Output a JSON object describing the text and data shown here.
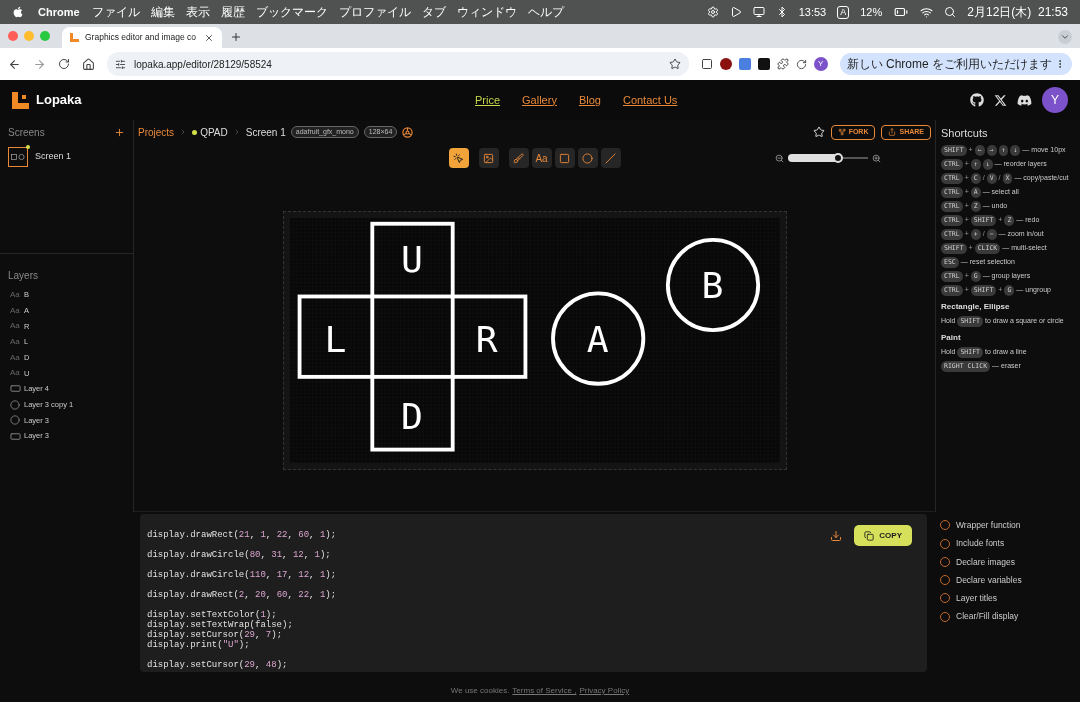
{
  "menu_bar": {
    "app": "Chrome",
    "items": [
      "ファイル",
      "編集",
      "表示",
      "履歴",
      "ブックマーク",
      "プロファイル",
      "タブ",
      "ウィンドウ",
      "ヘルプ"
    ],
    "time_small": "13:53",
    "input_mode": "A",
    "battery": "12%",
    "datetime": "2月12日(木)  21:53"
  },
  "browser": {
    "tab_title": "Graphics editor and image co",
    "url": "lopaka.app/editor/28129/58524",
    "profile": "Y",
    "update_button": "新しい Chrome をご利用いただけます"
  },
  "header": {
    "logo": "Lopaka",
    "nav": [
      {
        "label": "Price",
        "selected": true
      },
      {
        "label": "Gallery",
        "selected": false
      },
      {
        "label": "Blog",
        "selected": false
      },
      {
        "label": "Contact Us",
        "selected": false
      }
    ],
    "avatar": "Y"
  },
  "sidebar": {
    "screens_title": "Screens",
    "screens": [
      {
        "name": "Screen 1",
        "selected": true
      }
    ],
    "layers_title": "Layers",
    "layers": [
      {
        "kind": "text",
        "glyph": "Aa",
        "name": "B"
      },
      {
        "kind": "text",
        "glyph": "Aa",
        "name": "A"
      },
      {
        "kind": "text",
        "glyph": "Aa",
        "name": "R"
      },
      {
        "kind": "text",
        "glyph": "Aa",
        "name": "L"
      },
      {
        "kind": "text",
        "glyph": "Aa",
        "name": "D"
      },
      {
        "kind": "text",
        "glyph": "Aa",
        "name": "U"
      },
      {
        "kind": "rect",
        "name": "Layer 4"
      },
      {
        "kind": "circle",
        "name": "Layer 3 copy 1"
      },
      {
        "kind": "circle",
        "name": "Layer 3"
      },
      {
        "kind": "rect",
        "name": "Layer 3"
      }
    ]
  },
  "toolbar": {
    "breadcrumbs": [
      {
        "kind": "link",
        "label": "Projects"
      },
      {
        "kind": "project",
        "label": "QPAD"
      },
      {
        "kind": "current",
        "label": "Screen 1"
      }
    ],
    "badges": [
      "adafruit_gfx_mono",
      "128×64"
    ],
    "tools": [
      {
        "kind": "pointer",
        "selected": true
      },
      {
        "kind": "image",
        "selected": false
      },
      {
        "kind": "paint",
        "selected": false
      },
      {
        "kind": "text",
        "label": "Aa",
        "selected": false
      },
      {
        "kind": "rect",
        "selected": false
      },
      {
        "kind": "circle",
        "selected": false
      },
      {
        "kind": "line",
        "selected": false
      }
    ],
    "fork": "FORK",
    "share": "SHARE",
    "zoom": {
      "level": 0.62
    }
  },
  "canvas": {
    "letters": [
      "U",
      "L",
      "R",
      "D",
      "A",
      "B"
    ]
  },
  "shortcuts": {
    "title": "Shortcuts",
    "rows": [
      {
        "kind": "keys",
        "parts": [
          {
            "kind": "key",
            "text": "SHIFT"
          },
          {
            "kind": "sep",
            "text": "+"
          },
          {
            "kind": "key",
            "text": "←"
          },
          {
            "kind": "key",
            "text": "→"
          },
          {
            "kind": "key",
            "text": "↑"
          },
          {
            "kind": "key",
            "text": "↓"
          },
          {
            "kind": "text",
            "text": "— move 10px"
          }
        ]
      },
      {
        "kind": "keys",
        "parts": [
          {
            "kind": "key",
            "text": "CTRL"
          },
          {
            "kind": "sep",
            "text": "+"
          },
          {
            "kind": "key",
            "text": "↑"
          },
          {
            "kind": "key",
            "text": "↓"
          },
          {
            "kind": "text",
            "text": "— reorder layers"
          }
        ]
      },
      {
        "kind": "keys",
        "parts": [
          {
            "kind": "key",
            "text": "CTRL"
          },
          {
            "kind": "sep",
            "text": "+"
          },
          {
            "kind": "key",
            "text": "C"
          },
          {
            "kind": "sep",
            "text": "/"
          },
          {
            "kind": "key",
            "text": "V"
          },
          {
            "kind": "sep",
            "text": "/"
          },
          {
            "kind": "key",
            "text": "X"
          },
          {
            "kind": "text",
            "text": "— copy/paste/cut"
          }
        ]
      },
      {
        "kind": "keys",
        "parts": [
          {
            "kind": "key",
            "text": "CTRL"
          },
          {
            "kind": "sep",
            "text": "+"
          },
          {
            "kind": "key",
            "text": "A"
          },
          {
            "kind": "text",
            "text": "— select all"
          }
        ]
      },
      {
        "kind": "keys",
        "parts": [
          {
            "kind": "key",
            "text": "CTRL"
          },
          {
            "kind": "sep",
            "text": "+"
          },
          {
            "kind": "key",
            "text": "Z"
          },
          {
            "kind": "text",
            "text": "— undo"
          }
        ]
      },
      {
        "kind": "keys",
        "parts": [
          {
            "kind": "key",
            "text": "CTRL"
          },
          {
            "kind": "sep",
            "text": "+"
          },
          {
            "kind": "key",
            "text": "SHIFT"
          },
          {
            "kind": "sep",
            "text": "+"
          },
          {
            "kind": "key",
            "text": "Z"
          },
          {
            "kind": "text",
            "text": "— redo"
          }
        ]
      },
      {
        "kind": "keys",
        "parts": [
          {
            "kind": "key",
            "text": "CTRL"
          },
          {
            "kind": "sep",
            "text": "+"
          },
          {
            "kind": "key",
            "text": "+"
          },
          {
            "kind": "sep",
            "text": "/"
          },
          {
            "kind": "key",
            "text": "−"
          },
          {
            "kind": "text",
            "text": "— zoom in/out"
          }
        ]
      },
      {
        "kind": "keys",
        "parts": [
          {
            "kind": "key",
            "text": "SHIFT"
          },
          {
            "kind": "sep",
            "text": "+"
          },
          {
            "kind": "key",
            "text": "CLICK"
          },
          {
            "kind": "text",
            "text": "— multi-select"
          }
        ]
      },
      {
        "kind": "keys",
        "parts": [
          {
            "kind": "key",
            "text": "ESC"
          },
          {
            "kind": "text",
            "text": "— reset selection"
          }
        ]
      },
      {
        "kind": "keys",
        "parts": [
          {
            "kind": "key",
            "text": "CTRL"
          },
          {
            "kind": "sep",
            "text": "+"
          },
          {
            "kind": "key",
            "text": "G"
          },
          {
            "kind": "text",
            "text": "— group layers"
          }
        ]
      },
      {
        "kind": "keys",
        "parts": [
          {
            "kind": "key",
            "text": "CTRL"
          },
          {
            "kind": "sep",
            "text": "+"
          },
          {
            "kind": "key",
            "text": "SHIFT"
          },
          {
            "kind": "sep",
            "text": "+"
          },
          {
            "kind": "key",
            "text": "G"
          },
          {
            "kind": "text",
            "text": "— ungroup"
          }
        ]
      },
      {
        "kind": "heading",
        "text": "Rectangle, Ellipse"
      },
      {
        "kind": "keys",
        "parts": [
          {
            "kind": "text",
            "text": "Hold"
          },
          {
            "kind": "key",
            "text": "SHIFT"
          },
          {
            "kind": "text",
            "text": "to draw a square or circle"
          }
        ]
      },
      {
        "kind": "heading",
        "text": "Paint"
      },
      {
        "kind": "keys",
        "parts": [
          {
            "kind": "text",
            "text": "Hold"
          },
          {
            "kind": "key",
            "text": "SHIFT"
          },
          {
            "kind": "text",
            "text": "to draw a line"
          }
        ]
      },
      {
        "kind": "keys",
        "parts": [
          {
            "kind": "key",
            "text": "RIGHT CLICK"
          },
          {
            "kind": "text",
            "text": "— eraser"
          }
        ]
      }
    ]
  },
  "code": {
    "copy": "COPY",
    "blocks": [
      [
        "display.drawRect(21, 1, 22, 60, 1);"
      ],
      [
        "display.drawCircle(80, 31, 12, 1);"
      ],
      [
        "display.drawCircle(110, 17, 12, 1);"
      ],
      [
        "display.drawRect(2, 20, 60, 22, 1);"
      ],
      [
        "display.setTextColor(1);",
        "display.setTextWrap(false);",
        "display.setCursor(29, 7);",
        "display.print(\"U\");"
      ],
      [
        "display.setCursor(29, 48);"
      ]
    ]
  },
  "options": [
    {
      "label": "Wrapper function",
      "checked": false
    },
    {
      "label": "Include fonts",
      "checked": false
    },
    {
      "label": "Declare images",
      "checked": false
    },
    {
      "label": "Declare variables",
      "checked": false
    },
    {
      "label": "Layer titles",
      "checked": false
    },
    {
      "label": "Clear/Fill display",
      "checked": false
    }
  ],
  "footer": {
    "notice": "We use cookies.",
    "links": [
      "Terms of Service ,",
      "Privacy Policy"
    ]
  }
}
